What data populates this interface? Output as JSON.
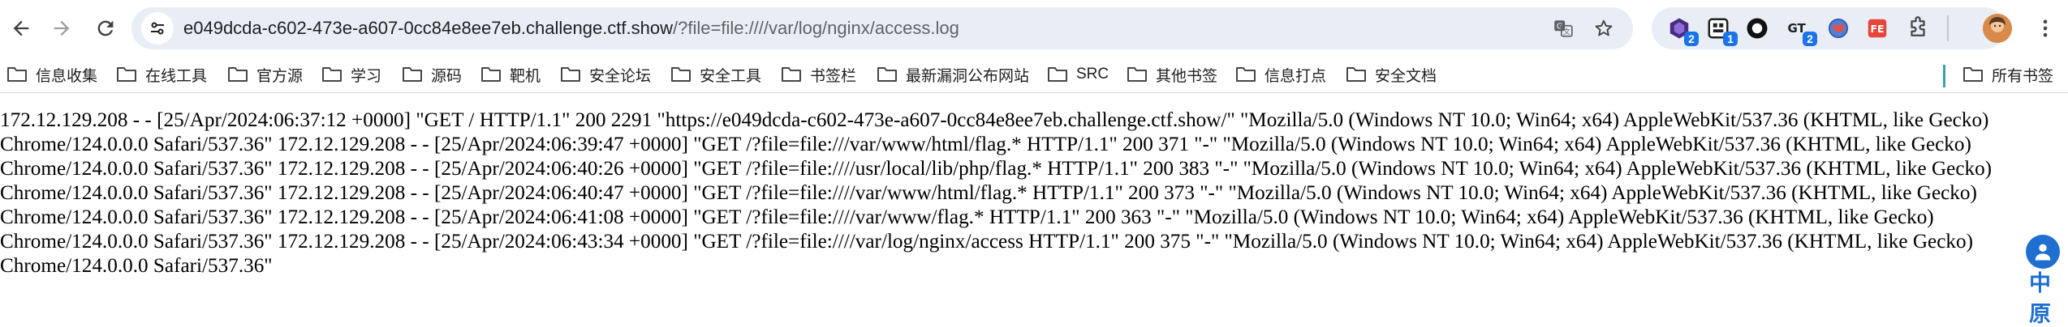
{
  "browser": {
    "url_host": "e049dcda-c602-473e-a607-0cc84e8ee7eb.challenge.ctf.show",
    "url_path": "/?file=file:////var/log/nginx/access.log",
    "extensions": [
      {
        "name": "hack-bar-icon",
        "badge": "2"
      },
      {
        "name": "proxy-switcher-icon",
        "badge": "1"
      },
      {
        "name": "github-icon",
        "badge": ""
      },
      {
        "name": "cookie-editor-icon",
        "badge": "2"
      },
      {
        "name": "globe-extension-icon",
        "badge": ""
      },
      {
        "name": "fe-helper-icon",
        "badge": ""
      },
      {
        "name": "extensions-puzzle-icon",
        "badge": ""
      }
    ],
    "accent_color": "#1a73e8",
    "omnibox_bg": "#e9eef6"
  },
  "bookmarks": {
    "items": [
      "信息收集",
      "在线工具",
      "官方源",
      "学习",
      "源码",
      "靶机",
      "安全论坛",
      "安全工具",
      "书签栏",
      "最新漏洞公布网站",
      "SRC",
      "其他书签",
      "信息打点",
      "安全文档"
    ],
    "all_bookmarks": "所有书签"
  },
  "page": {
    "log_text": "172.12.129.208 - - [25/Apr/2024:06:37:12 +0000] \"GET / HTTP/1.1\" 200 2291 \"https://e049dcda-c602-473e-a607-0cc84e8ee7eb.challenge.ctf.show/\" \"Mozilla/5.0 (Windows NT 10.0; Win64; x64) AppleWebKit/537.36 (KHTML, like Gecko) Chrome/124.0.0.0 Safari/537.36\" 172.12.129.208 - - [25/Apr/2024:06:39:47 +0000] \"GET /?file=file:///var/www/html/flag.* HTTP/1.1\" 200 371 \"-\" \"Mozilla/5.0 (Windows NT 10.0; Win64; x64) AppleWebKit/537.36 (KHTML, like Gecko) Chrome/124.0.0.0 Safari/537.36\" 172.12.129.208 - - [25/Apr/2024:06:40:26 +0000] \"GET /?file=file:////usr/local/lib/php/flag.* HTTP/1.1\" 200 383 \"-\" \"Mozilla/5.0 (Windows NT 10.0; Win64; x64) AppleWebKit/537.36 (KHTML, like Gecko) Chrome/124.0.0.0 Safari/537.36\" 172.12.129.208 - - [25/Apr/2024:06:40:47 +0000] \"GET /?file=file:////var/www/html/flag.* HTTP/1.1\" 200 373 \"-\" \"Mozilla/5.0 (Windows NT 10.0; Win64; x64) AppleWebKit/537.36 (KHTML, like Gecko) Chrome/124.0.0.0 Safari/537.36\" 172.12.129.208 - - [25/Apr/2024:06:41:08 +0000] \"GET /?file=file:////var/www/flag.* HTTP/1.1\" 200 363 \"-\" \"Mozilla/5.0 (Windows NT 10.0; Win64; x64) AppleWebKit/537.36 (KHTML, like Gecko) Chrome/124.0.0.0 Safari/537.36\" 172.12.129.208 - - [25/Apr/2024:06:43:34 +0000] \"GET /?file=file:////var/log/nginx/access HTTP/1.1\" 200 375 \"-\" \"Mozilla/5.0 (Windows NT 10.0; Win64; x64) AppleWebKit/537.36 (KHTML, like Gecko) Chrome/124.0.0.0 Safari/537.36\""
  },
  "side_widget": {
    "char1": "中",
    "char2": "原",
    "color": "#1e6fd0"
  }
}
